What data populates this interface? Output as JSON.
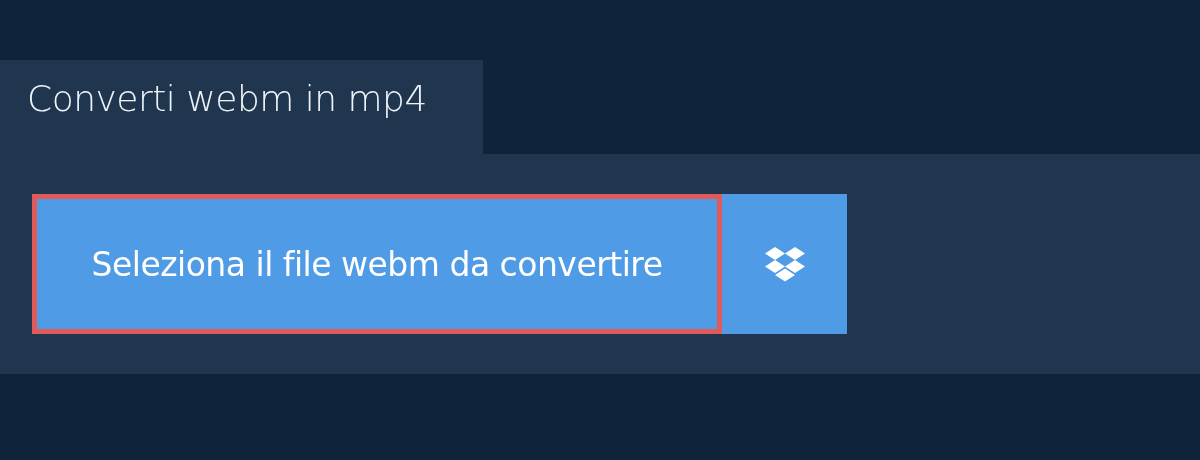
{
  "tab": {
    "label": "Converti webm in mp4"
  },
  "select_button": {
    "label": "Seleziona il file webm da convertire",
    "highlighted": true
  },
  "dropbox_button": {
    "kind": "dropbox"
  }
}
